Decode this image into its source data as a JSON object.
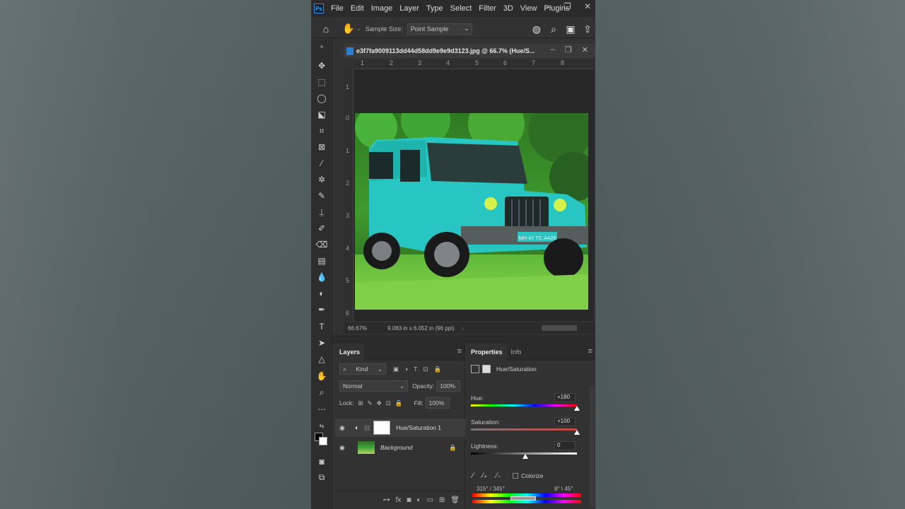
{
  "app": {
    "logo": "Ps"
  },
  "menu": [
    "File",
    "Edit",
    "Image",
    "Layer",
    "Type",
    "Select",
    "Filter",
    "3D",
    "View",
    "Plugins"
  ],
  "options_bar": {
    "sample_size_label": "Sample Size:",
    "sample_size_value": "Point Sample"
  },
  "document": {
    "title": "e3f7fa9009113dd44d58dd9e9e9d3123.jpg @ 66.7% (Hue/S...",
    "ruler_top": [
      "1",
      "2",
      "3",
      "4",
      "5",
      "6",
      "7",
      "8"
    ],
    "ruler_left": [
      "1",
      "0",
      "1",
      "2",
      "3",
      "4",
      "5",
      "6"
    ],
    "zoom": "66.67%",
    "dimensions": "9.083 in x 6.052 in (96 ppi)",
    "plate_text": "MH 47 TC A425"
  },
  "layers_panel": {
    "tab": "Layers",
    "filter": "Kind",
    "blend_mode": "Normal",
    "opacity_label": "Opacity:",
    "opacity_value": "100%",
    "lock_label": "Lock:",
    "fill_label": "Fill:",
    "fill_value": "100%",
    "layers": [
      {
        "name": "Hue/Saturation 1",
        "selected": true
      },
      {
        "name": "Background",
        "selected": false
      }
    ]
  },
  "properties_panel": {
    "tabs": [
      "Properties",
      "Info"
    ],
    "header": "Hue/Saturation",
    "hue_label": "Hue:",
    "hue_value": "+180",
    "saturation_label": "Saturation:",
    "saturation_value": "+100",
    "lightness_label": "Lightness:",
    "lightness_value": "0",
    "colorize_label": "Colorize",
    "range_left": "315° / 345°",
    "range_right": "8° \\ 45°"
  },
  "colors": {
    "jeep": "#2cd3cc",
    "grass": "#6fcc3a",
    "accent": "#31a8ff"
  }
}
